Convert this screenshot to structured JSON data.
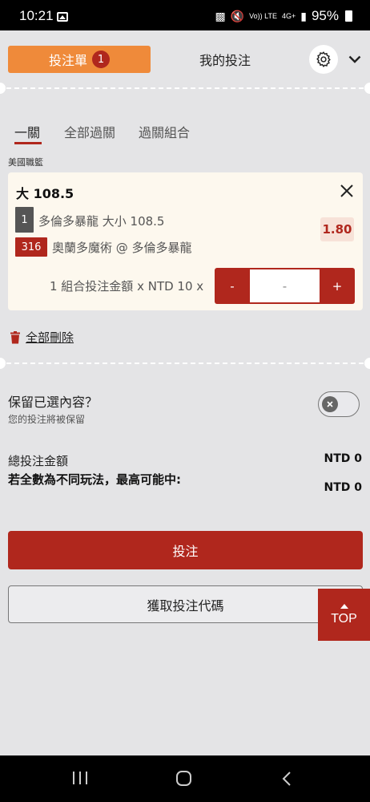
{
  "status_bar": {
    "time": "10:21",
    "battery": "95%",
    "volte": "Vo)) LTE",
    "network": "4G+"
  },
  "header": {
    "betslip_label": "投注單",
    "betslip_count": "1",
    "mybets_label": "我的投注"
  },
  "tabs": [
    {
      "label": "一關"
    },
    {
      "label": "全部過關"
    },
    {
      "label": "過關組合"
    }
  ],
  "league": "美國職籃",
  "bet": {
    "selection": "大 108.5",
    "leg_number": "1",
    "leg_text": "多倫多暴龍 大小 108.5",
    "event_number": "316",
    "event_text": "奧蘭多魔術 @ 多倫多暴龍",
    "odds": "1.80",
    "stake_label": "1 組合投注金額 x NTD 10 x",
    "stepper_minus": "-",
    "stepper_value": "-",
    "stepper_plus": "+"
  },
  "delete_all": "全部刪除",
  "retain": {
    "title": "保留已選內容？",
    "subtitle": "您的投注將被保留"
  },
  "totals": {
    "total_label": "總投注金額",
    "total_value": "NTD 0",
    "maxwin_label": "若全數為不同玩法，最高可能中:",
    "maxwin_value": "NTD 0"
  },
  "buttons": {
    "place_bet": "投注",
    "get_code": "獲取投注代碼",
    "top": "TOP"
  },
  "colors": {
    "accent_red": "#b0271d",
    "tab_orange": "#ef8a3a"
  }
}
